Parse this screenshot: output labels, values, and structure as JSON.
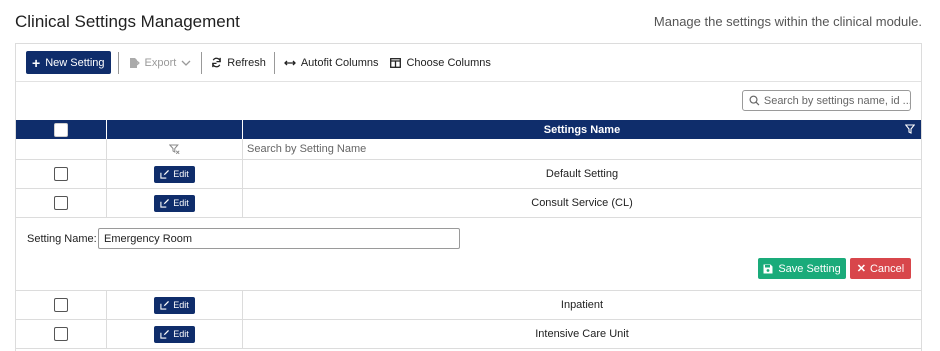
{
  "page": {
    "title": "Clinical Settings Management",
    "description": "Manage the settings within the clinical module."
  },
  "toolbar": {
    "new_label": "New Setting",
    "export_label": "Export",
    "refresh_label": "Refresh",
    "autofit_label": "Autofit Columns",
    "choose_label": "Choose Columns"
  },
  "search": {
    "placeholder": "Search by settings name, id ..."
  },
  "grid": {
    "header_name": "Settings Name",
    "filter_placeholder": "Search by Setting Name",
    "edit_label": "Edit",
    "rows": [
      {
        "name": "Default Setting"
      },
      {
        "name": "Consult Service (CL)"
      },
      {
        "name": "Inpatient"
      },
      {
        "name": "Intensive Care Unit"
      }
    ]
  },
  "edit_form": {
    "label": "Setting Name:",
    "value": "Emergency Room",
    "save_label": "Save Setting",
    "cancel_label": "Cancel"
  },
  "colors": {
    "primary": "#0f2d6b",
    "save": "#1aab7a",
    "cancel": "#d8464b"
  }
}
